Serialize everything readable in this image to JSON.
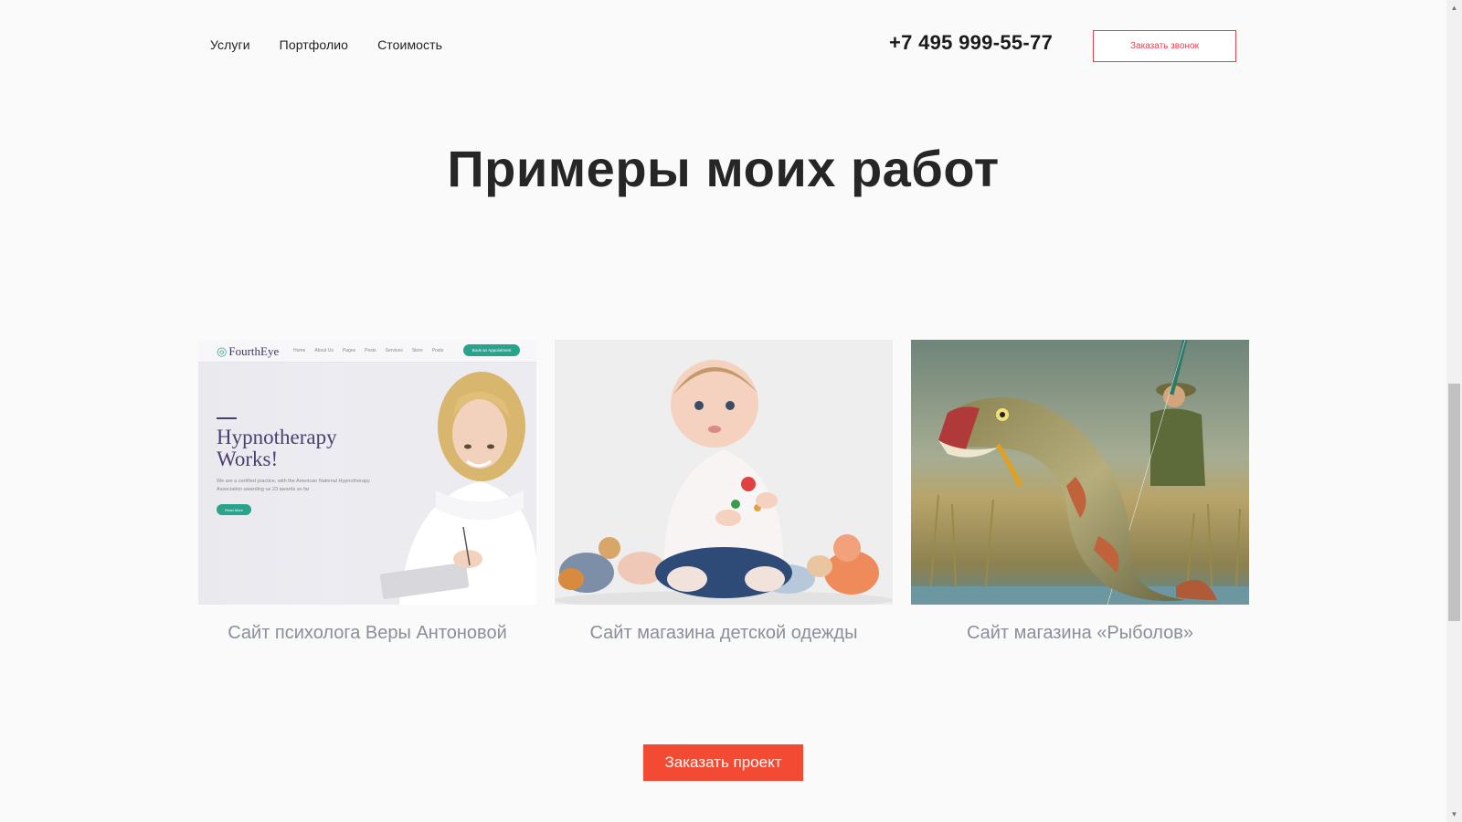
{
  "nav": {
    "items": [
      {
        "label": "Услуги"
      },
      {
        "label": "Портфолио"
      },
      {
        "label": "Стоимость"
      }
    ]
  },
  "header": {
    "phone": "+7 495 999-55-77",
    "callback_label": "Заказать звонок"
  },
  "section": {
    "title": "Примеры моих работ"
  },
  "portfolio": [
    {
      "caption": "Сайт психолога Веры Антоновой",
      "mockup": {
        "logo": "FourthEye",
        "menu": [
          "Home",
          "About Us",
          "Pages",
          "Posts",
          "Services",
          "Store",
          "Posts"
        ],
        "appointment": "Book an Appointment",
        "headline_1": "Hypnotherapy",
        "headline_2": "Works!",
        "subtext": "We are a certified practice, with the American National Hypnotherapy Association awarding us 23 awards so far",
        "read_more": "Read More"
      }
    },
    {
      "caption": "Сайт магазина детской одежды"
    },
    {
      "caption": "Сайт магазина «Рыболов»"
    }
  ],
  "cta": {
    "order_label": "Заказать проект"
  },
  "colors": {
    "accent": "#f24a33",
    "callback_border": "#e1424f",
    "caption": "#8a8f99",
    "mockup_green": "#2aa38c"
  }
}
